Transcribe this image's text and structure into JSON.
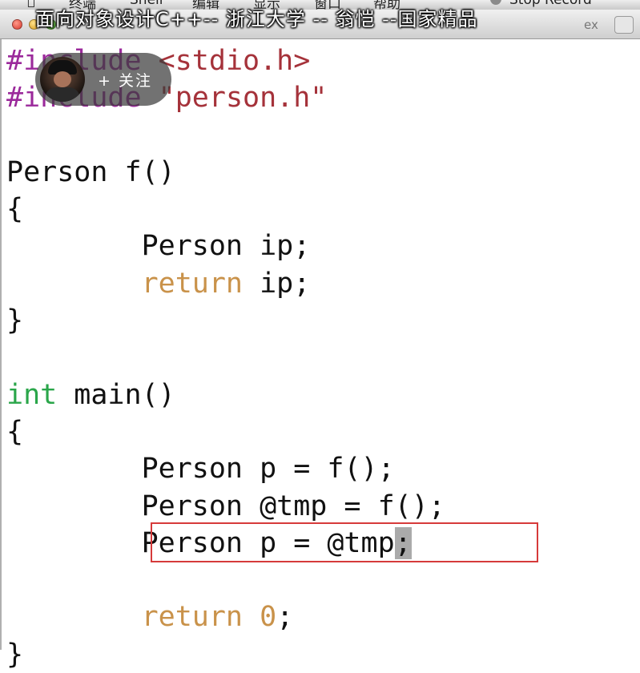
{
  "menubar": {
    "items": [
      "终端",
      "Shell",
      "编辑",
      "显示",
      "窗口",
      "帮助"
    ],
    "stop_record": "Stop Record"
  },
  "overlay": {
    "title": "面向对象设计C++-- 浙江大学 -- 翁恺 --国家精品"
  },
  "titlebar": {
    "right_text": "ex"
  },
  "follow": {
    "label": "+ 关注"
  },
  "code": {
    "lines": [
      [
        {
          "t": "#include",
          "c": "kw-pre"
        },
        {
          "t": " "
        },
        {
          "t": "<stdio.h>",
          "c": "kw-str"
        }
      ],
      [
        {
          "t": "#include",
          "c": "kw-pre"
        },
        {
          "t": " "
        },
        {
          "t": "\"person.h\"",
          "c": "kw-str"
        }
      ],
      [],
      [
        {
          "t": "Person f()"
        }
      ],
      [
        {
          "t": "{"
        }
      ],
      [
        {
          "t": "        Person ip;"
        }
      ],
      [
        {
          "t": "        "
        },
        {
          "t": "return",
          "c": "kw-ret"
        },
        {
          "t": " ip;"
        }
      ],
      [
        {
          "t": "}"
        }
      ],
      [],
      [
        {
          "t": "int",
          "c": "kw-int"
        },
        {
          "t": " main()"
        }
      ],
      [
        {
          "t": "{"
        }
      ],
      [
        {
          "t": "        Person p = f();"
        }
      ],
      [
        {
          "t": "        Person @tmp = f();"
        }
      ],
      [
        {
          "t": "        Person p = @tmp"
        },
        {
          "t": ";",
          "c": "cursor"
        }
      ],
      [],
      [
        {
          "t": "        "
        },
        {
          "t": "return",
          "c": "kw-ret"
        },
        {
          "t": " "
        },
        {
          "t": "0",
          "c": "kw-ret"
        },
        {
          "t": ";"
        }
      ],
      [
        {
          "t": "}"
        }
      ]
    ]
  },
  "colors": {
    "preprocessor": "#9b2a9b",
    "string": "#a5323a",
    "return_keyword": "#c9924a",
    "type_keyword": "#2aa64a",
    "highlight_box": "#d63a3a"
  }
}
